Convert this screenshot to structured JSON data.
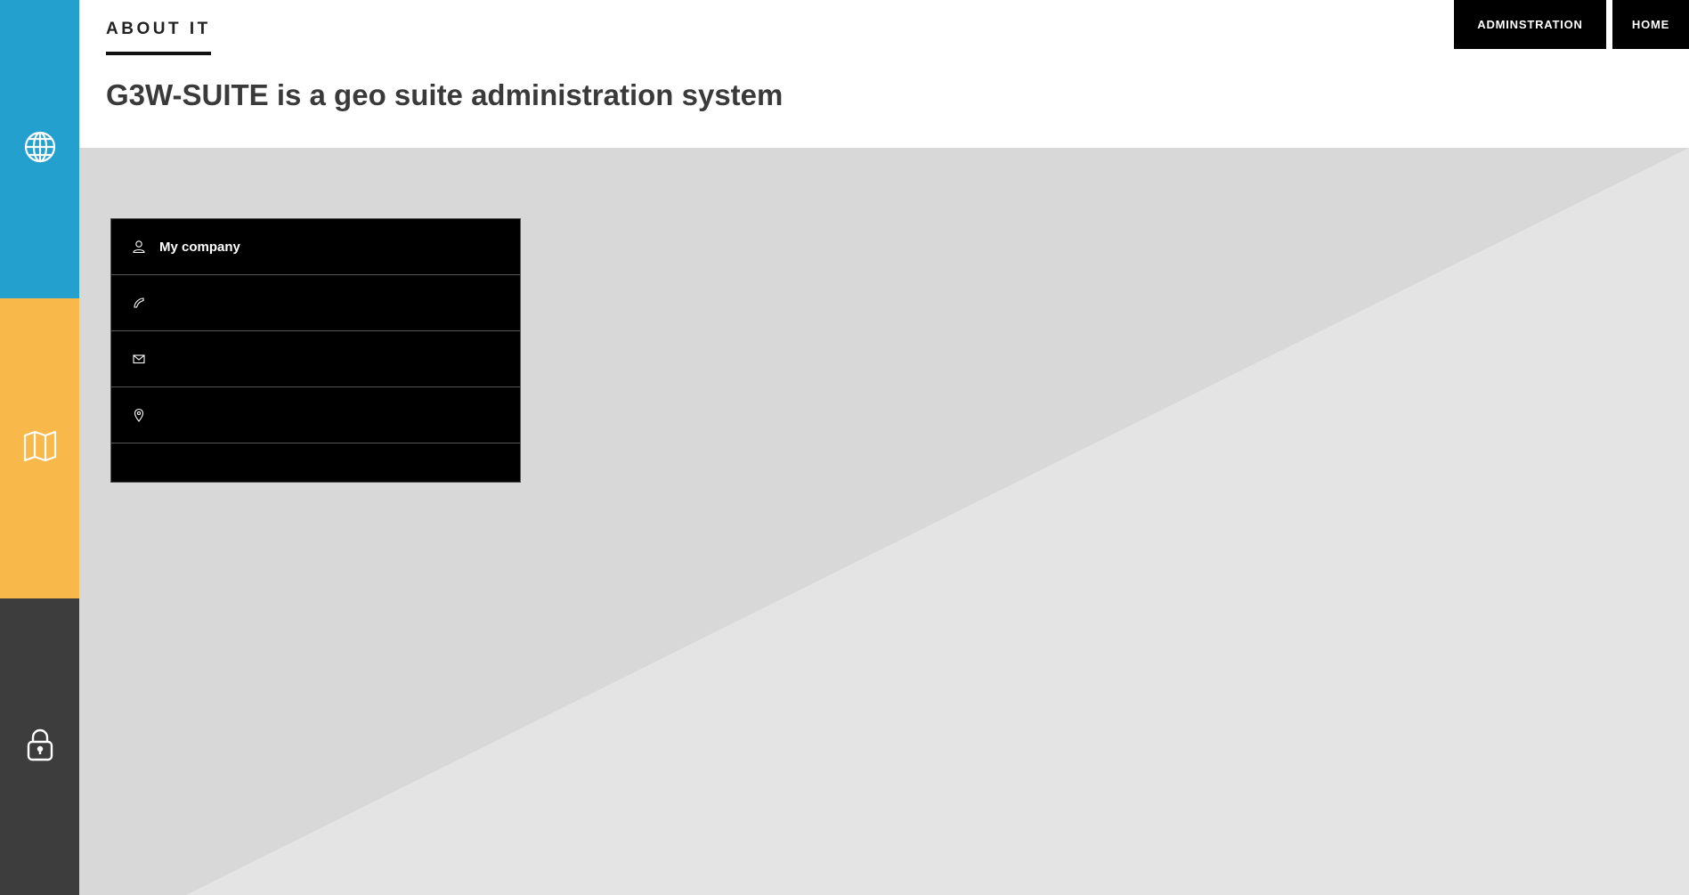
{
  "colors": {
    "sidebar_blue": "#23a0cd",
    "sidebar_yellow": "#f9b84a",
    "sidebar_dark": "#3d3d3d",
    "nav_bg": "#000000",
    "content_bg_dark": "#d9d8d9",
    "content_bg_light": "#e4e4e4"
  },
  "sidebar": {
    "items": [
      {
        "icon": "globe-icon"
      },
      {
        "icon": "map-icon"
      },
      {
        "icon": "lock-icon"
      }
    ]
  },
  "header": {
    "section_label": "ABOUT IT",
    "title": "G3W-SUITE is a geo suite administration system"
  },
  "topnav": {
    "admin_label": "ADMINSTRATION",
    "home_label": "HOME"
  },
  "contact_card": {
    "rows": [
      {
        "icon": "user-icon",
        "text": "My company"
      },
      {
        "icon": "phone-icon",
        "text": ""
      },
      {
        "icon": "mail-icon",
        "text": ""
      },
      {
        "icon": "location-pin-icon",
        "text": ""
      },
      {
        "icon": "",
        "text": ""
      }
    ]
  }
}
